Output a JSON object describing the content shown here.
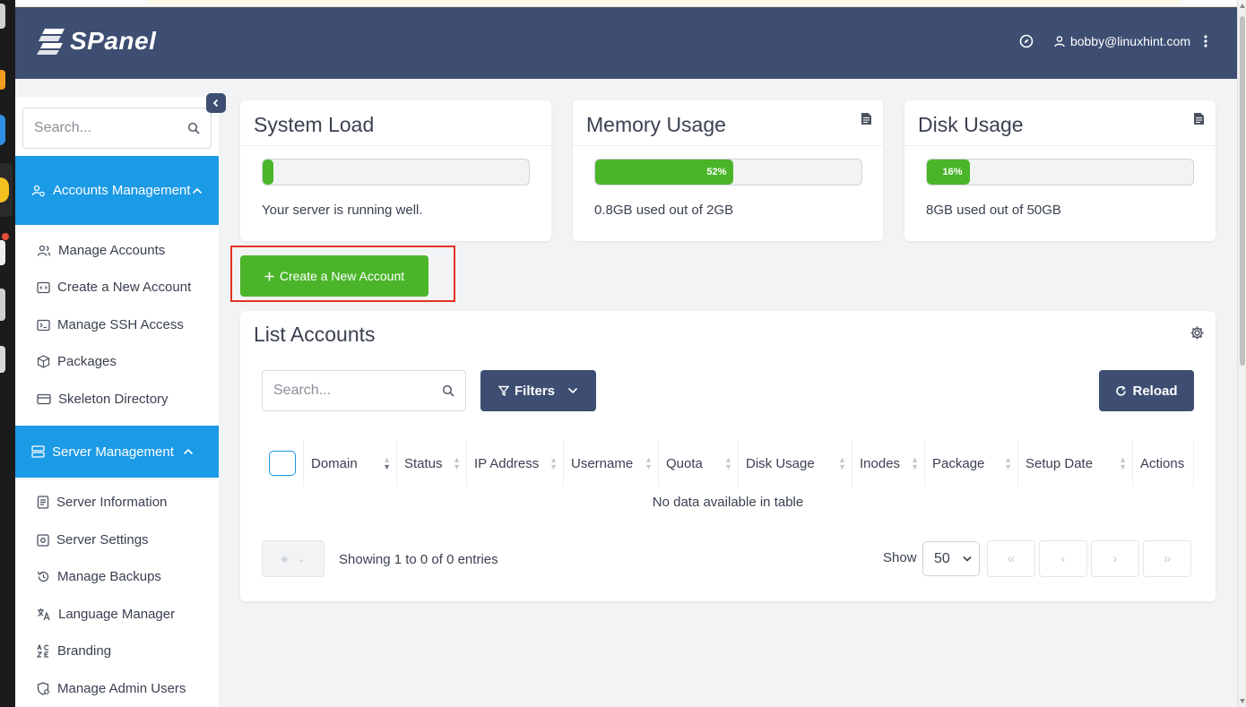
{
  "header": {
    "logo_text": "SPanel",
    "user_email": "bobby@linuxhint.com",
    "icons": [
      "compass-icon",
      "user-icon",
      "kebab-menu-icon"
    ]
  },
  "sidebar": {
    "search_placeholder": "Search...",
    "sections": [
      {
        "label": "Accounts Management",
        "icon": "accounts-icon",
        "items": [
          {
            "label": "Manage Accounts",
            "icon": "users-icon"
          },
          {
            "label": "Create a New Account",
            "icon": "code-window-icon"
          },
          {
            "label": "Manage SSH Access",
            "icon": "terminal-icon"
          },
          {
            "label": "Packages",
            "icon": "package-icon"
          },
          {
            "label": "Skeleton Directory",
            "icon": "card-icon"
          }
        ]
      },
      {
        "label": "Server Management",
        "icon": "server-icon",
        "items": [
          {
            "label": "Server Information",
            "icon": "document-icon"
          },
          {
            "label": "Server Settings",
            "icon": "settings-icon"
          },
          {
            "label": "Manage Backups",
            "icon": "history-icon"
          },
          {
            "label": "Language Manager",
            "icon": "translate-icon"
          },
          {
            "label": "Branding",
            "icon": "branding-icon"
          },
          {
            "label": "Manage Admin Users",
            "icon": "shield-user-icon"
          }
        ]
      }
    ]
  },
  "widgets": {
    "system_load": {
      "title": "System Load",
      "progress": 0.04,
      "progress_label": "",
      "text": "Your server is running well."
    },
    "memory_usage": {
      "title": "Memory Usage",
      "progress": 0.52,
      "progress_label": "52%",
      "text": "0.8GB used out of 2GB"
    },
    "disk_usage": {
      "title": "Disk Usage",
      "progress": 0.16,
      "progress_label": "16%",
      "text": "8GB used out of 50GB"
    }
  },
  "create_button_label": "Create a New Account",
  "list_accounts": {
    "title": "List Accounts",
    "search_placeholder": "Search...",
    "filters_label": "Filters",
    "reload_label": "Reload",
    "columns": [
      "Domain",
      "Status",
      "IP Address",
      "Username",
      "Quota",
      "Disk Usage",
      "Inodes",
      "Package",
      "Setup Date",
      "Actions"
    ],
    "empty_message": "No data available in table",
    "showing_text": "Showing 1 to 0 of 0 entries",
    "show_label": "Show",
    "page_size": "50",
    "pagination": [
      "«",
      "‹",
      "›",
      "»"
    ]
  },
  "colors": {
    "header_bg": "#3d4e72",
    "sidebar_active": "#1b9ae6",
    "progress_green": "#4bb52a",
    "highlight_red": "#e2321f"
  }
}
